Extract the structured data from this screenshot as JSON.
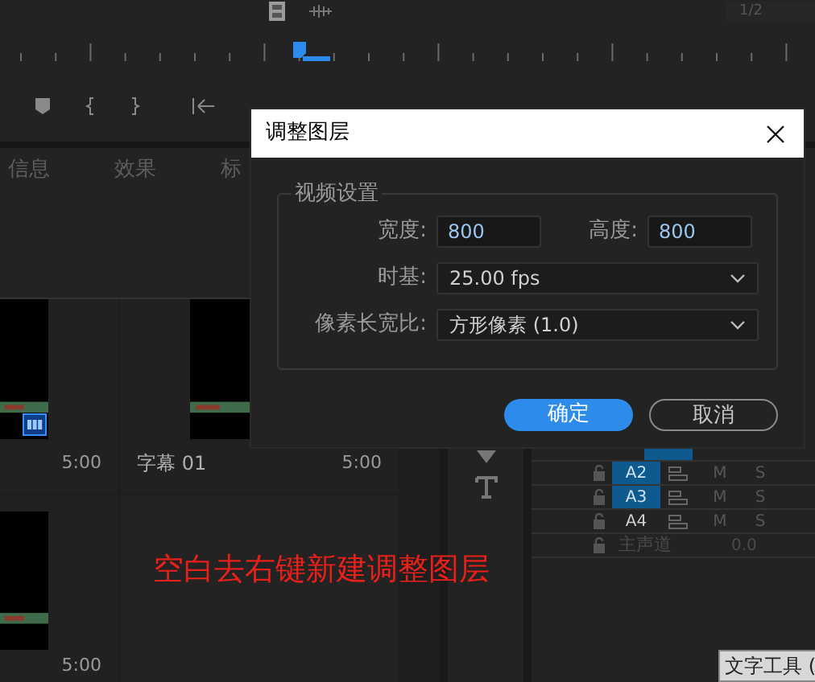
{
  "top_bar": {
    "page_indicator": "1/2"
  },
  "panel_tabs": [
    {
      "label": "信息"
    },
    {
      "label": "效果"
    },
    {
      "label": "标"
    }
  ],
  "project_items": [
    {
      "duration": "5:00",
      "badge": true
    },
    {
      "name": "字幕 01",
      "duration": "5:00",
      "badge": false
    },
    {
      "duration": "5:00",
      "badge": false
    }
  ],
  "annotation": "空白去右键新建调整图层",
  "audio_tracks": [
    {
      "label": "A2",
      "selected": true,
      "mute": "M",
      "solo": "S"
    },
    {
      "label": "A3",
      "selected": true,
      "mute": "M",
      "solo": "S"
    },
    {
      "label": "A4",
      "selected": false,
      "mute": "M",
      "solo": "S"
    }
  ],
  "master_track": {
    "label": "主声道",
    "value": "0.0"
  },
  "tooltip": "文字工具 (",
  "dialog": {
    "title": "调整图层",
    "group": "视频设置",
    "width": {
      "label": "宽度:",
      "value": "800"
    },
    "height": {
      "label": "高度:",
      "value": "800"
    },
    "timebase": {
      "label": "时基:",
      "value": "25.00 fps"
    },
    "pixel_aspect": {
      "label": "像素长宽比:",
      "value": "方形像素 (1.0)"
    },
    "buttons": [
      {
        "label": "确定",
        "kind": "primary"
      },
      {
        "label": "取消",
        "kind": "secondary"
      }
    ]
  }
}
